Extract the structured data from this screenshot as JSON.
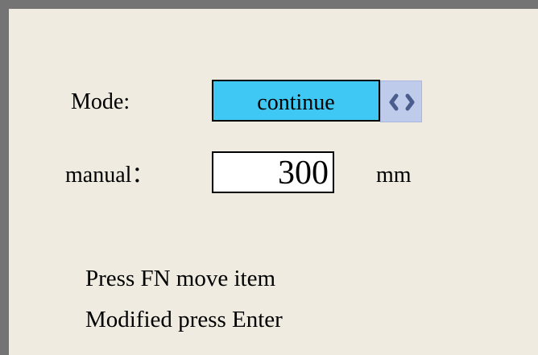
{
  "mode": {
    "label": "Mode:",
    "value": "continue",
    "toggle_icon": "left-right-arrows-icon"
  },
  "manual": {
    "label": "manual：",
    "value": "300",
    "unit": "mm"
  },
  "hints": {
    "line1": "Press FN move item",
    "line2": "Modified press Enter"
  },
  "colors": {
    "panel_background": "#efebe0",
    "frame": "#747474",
    "selected_field": "#3fc8f4",
    "arrow_button": "#bfcbeb",
    "arrow_glyph": "#4a5d8c"
  }
}
